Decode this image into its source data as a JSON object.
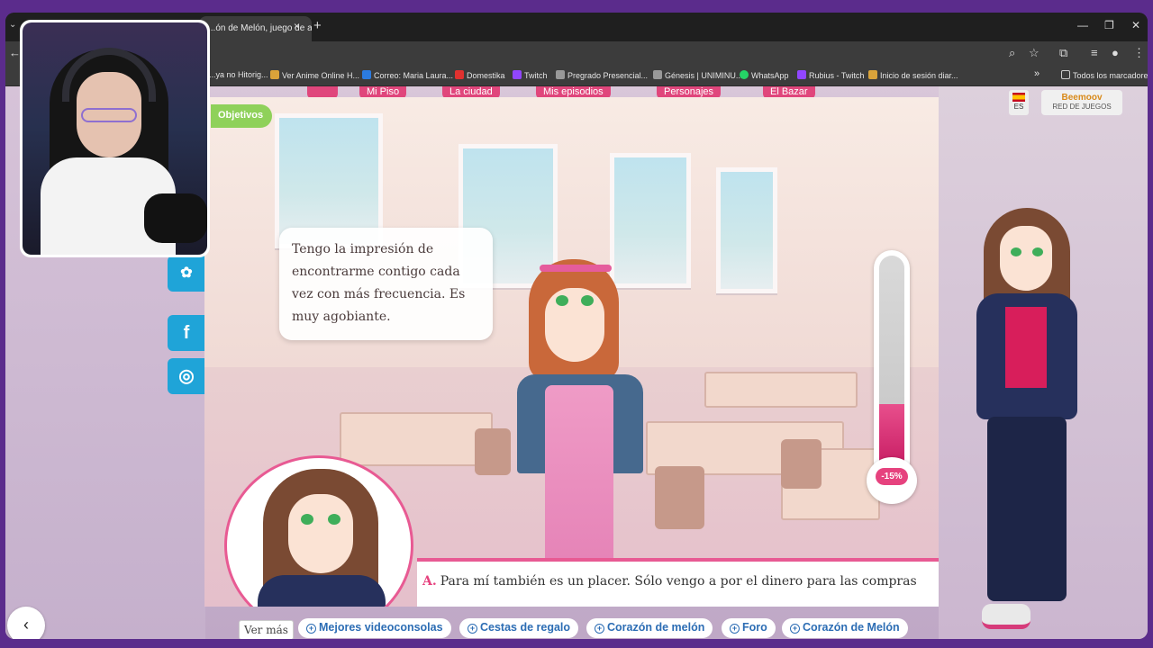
{
  "browser": {
    "tab_title": "...ón de Melón, juego de ar...",
    "tab_close": "×",
    "new_tab": "+",
    "window_controls": [
      "—",
      "❐",
      "✕"
    ],
    "bookmarks": [
      {
        "label": "...ya no Hitorig...",
        "color": "#888888"
      },
      {
        "label": "Ver Anime Online H...",
        "color": "#d9a33a"
      },
      {
        "label": "Correo: Maria Laura...",
        "color": "#2b7be0"
      },
      {
        "label": "Domestika",
        "color": "#e0312f"
      },
      {
        "label": "Twitch",
        "color": "#9146ff"
      },
      {
        "label": "Pregrado Presencial...",
        "color": "#999999"
      },
      {
        "label": "Génesis | UNIMINU...",
        "color": "#999999"
      },
      {
        "label": "WhatsApp",
        "color": "#25d366"
      },
      {
        "label": "Rubius - Twitch",
        "color": "#9146ff"
      },
      {
        "label": "Inicio de sesión diar...",
        "color": "#d9a33a"
      }
    ],
    "bookmarks_overflow": "»",
    "all_bookmarks": "Todos los marcadores"
  },
  "site": {
    "nav_tabs": [
      "Mi Piso",
      "La ciudad",
      "Mis episodios",
      "Personajes",
      "El Bazar"
    ],
    "language": "ES",
    "network_brand": "Beemoov",
    "network_label": "RED DE JUEGOS",
    "social": {
      "facebook": "f",
      "instagram": "◎",
      "settings": "✿"
    }
  },
  "game": {
    "objectives_button": "Objetivos",
    "dialogue": "Tengo la impresión de encontrarme contigo cada vez con más frecuencia. Es muy agobiante.",
    "love_meter_label": "-15%",
    "love_meter_fill": 0.32,
    "answer_letter": "A.",
    "answer_text": "Para mí también es un placer. Sólo vengo a por el dinero para las compras"
  },
  "footer": {
    "back_icon": "‹",
    "ver_mas": "Ver más",
    "links": [
      "Mejores videoconsolas",
      "Cestas de regalo",
      "Corazón de melón",
      "Foro",
      "Corazón de Melón"
    ]
  }
}
